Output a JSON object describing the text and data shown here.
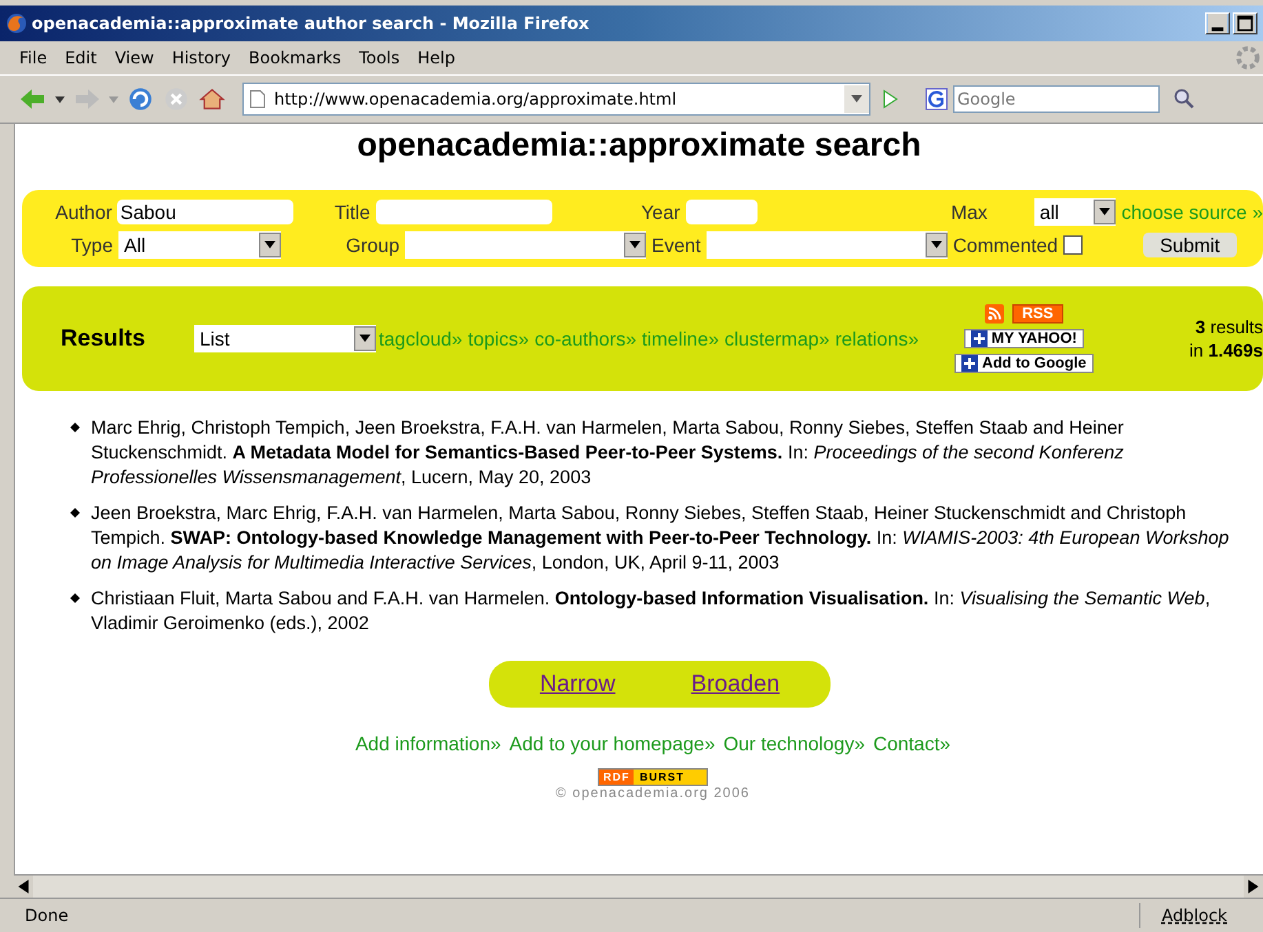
{
  "window": {
    "title": "openacademia::approximate author search - Mozilla Firefox"
  },
  "menu": [
    "File",
    "Edit",
    "View",
    "History",
    "Bookmarks",
    "Tools",
    "Help"
  ],
  "address": {
    "value": "http://www.openacademia.org/approximate.html"
  },
  "search": {
    "placeholder": "Google"
  },
  "page_title": "openacademia::approximate search",
  "form": {
    "author": {
      "label": "Author",
      "value": "Sabou"
    },
    "title": {
      "label": "Title"
    },
    "year": {
      "label": "Year"
    },
    "max": {
      "label": "Max",
      "value": "all"
    },
    "choose_source": "choose source »",
    "type": {
      "label": "Type",
      "value": "All"
    },
    "group": {
      "label": "Group"
    },
    "event": {
      "label": "Event"
    },
    "commented": {
      "label": "Commented",
      "checked": false
    },
    "submit": "Submit"
  },
  "results_bar": {
    "label": "Results",
    "view": "List",
    "links": [
      "tagcloud»",
      "topics»",
      "co-authors»",
      "timeline»",
      "clustermap»",
      "relations»"
    ],
    "rss": "RSS",
    "my_yahoo": "MY YAHOO!",
    "add_google": "Add to Google",
    "count": "3",
    "count_suffix": "results",
    "time_prefix": "in",
    "time": "1.469s"
  },
  "results": [
    "Marc Ehrig, Christoph Tempich, Jeen Broekstra, F.A.H. van Harmelen, Marta Sabou, Ronny Siebes, Steffen Staab and Heiner Stuckenschmidt. **A Metadata Model for Semantics-Based Peer-to-Peer Systems.** In: *Proceedings of the second Konferenz Professionelles Wissensmanagement*, Lucern, May 20, 2003",
    "Jeen Broekstra, Marc Ehrig, F.A.H. van Harmelen, Marta Sabou, Ronny Siebes, Steffen Staab, Heiner Stuckenschmidt and Christoph Tempich. **SWAP: Ontology-based Knowledge Management with Peer-to-Peer Technology.** In: *WIAMIS-2003: 4th European Workshop on Image Analysis for Multimedia Interactive Services*, London, UK, April 9-11, 2003",
    "Christiaan Fluit, Marta Sabou and F.A.H. van Harmelen. **Ontology-based Information Visualisation.** In: *Visualising the Semantic Web*, Vladimir Geroimenko (eds.), 2002"
  ],
  "narrow": "Narrow",
  "broaden": "Broaden",
  "footer_links": [
    "Add information»",
    "Add to your homepage»",
    "Our technology»",
    "Contact»"
  ],
  "badge": {
    "left": "RDF",
    "right": "BURST"
  },
  "copyright": "© openacademia.org 2006",
  "status_bar": {
    "text": "Done",
    "adblock": "Adblock"
  }
}
